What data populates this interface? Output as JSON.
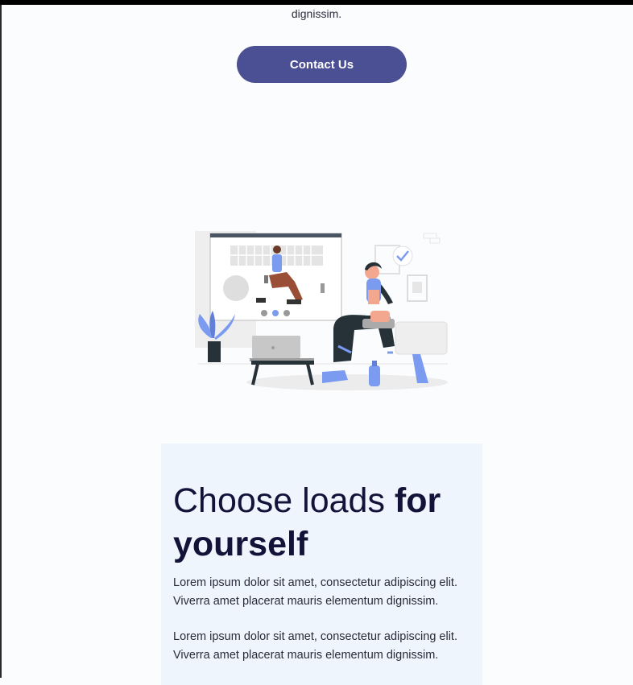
{
  "intro": {
    "trailing_text": "dignissim."
  },
  "cta": {
    "label": "Contact Us",
    "color": "#4b4f93"
  },
  "illustration": {
    "name": "online-fitness-workout-illustration",
    "accent": "#7b9bf0"
  },
  "feature": {
    "title_light": "Choose loads",
    "title_bold_1": "for",
    "title_bold_2": "yourself",
    "paragraphs": [
      "Lorem ipsum dolor sit amet, consectetur adipiscing elit. Viverra amet placerat mauris elementum dignissim.",
      "Lorem ipsum dolor sit amet, consectetur adipiscing elit. Viverra amet placerat mauris elementum dignissim."
    ]
  }
}
